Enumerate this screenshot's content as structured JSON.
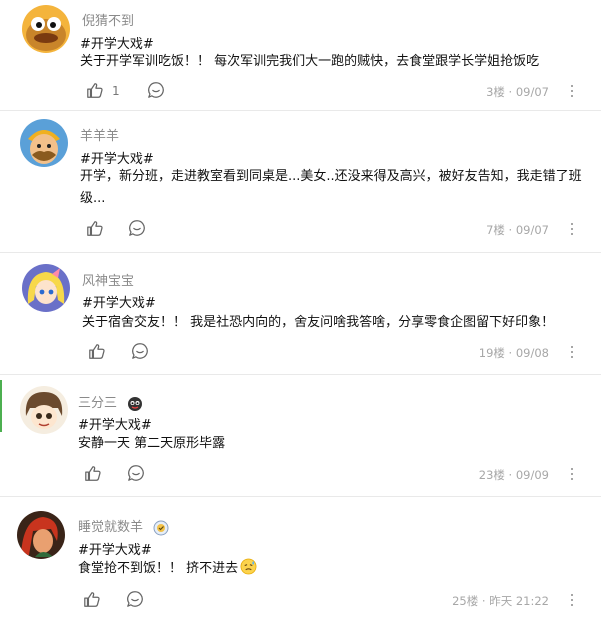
{
  "comments": [
    {
      "username": "倪猜不到",
      "hashtag": "#开学大戏#",
      "text": "关于开学军训吃饭！！ 每次军训完我们大一跑的贼快，去食堂跟学长学姐抢饭吃",
      "like_count": "1",
      "floor_date": "3楼 · 09/07",
      "avatar": "duck-character"
    },
    {
      "username": "羊羊羊",
      "hashtag": "#开学大戏#",
      "text": "开学，新分班，走进教室看到同桌是...美女..还没来得及高兴，被好友告知，我走错了班级...",
      "like_count": "",
      "floor_date": "7楼 · 09/07",
      "avatar": "barbarian-character"
    },
    {
      "username": "风神宝宝",
      "hashtag": "#开学大戏#",
      "text": "关于宿舍交友！！ 我是社恐内向的，舍友问啥我答啥，分享零食企图留下好印象！",
      "like_count": "",
      "floor_date": "19楼 · 09/08",
      "avatar": "anime-blonde-girl"
    },
    {
      "username": "三分三",
      "hashtag": "#开学大戏#",
      "text": "安静一天 第二天原形毕露",
      "like_count": "",
      "floor_date": "23楼 · 09/09",
      "avatar": "chibi-boy",
      "badge": "creature-badge"
    },
    {
      "username": "睡觉就数羊",
      "hashtag": "#开学大戏#",
      "text": "食堂抢不到饭！！ 挤不进去",
      "like_count": "",
      "floor_date": "25楼 · 昨天 21:22",
      "avatar": "red-hair-hero",
      "badge": "level-badge",
      "emoji": "sweat-face-emoji"
    }
  ],
  "colors": {
    "meta": "#a7a7a7",
    "username": "#8a8a8a",
    "text": "#111111"
  }
}
